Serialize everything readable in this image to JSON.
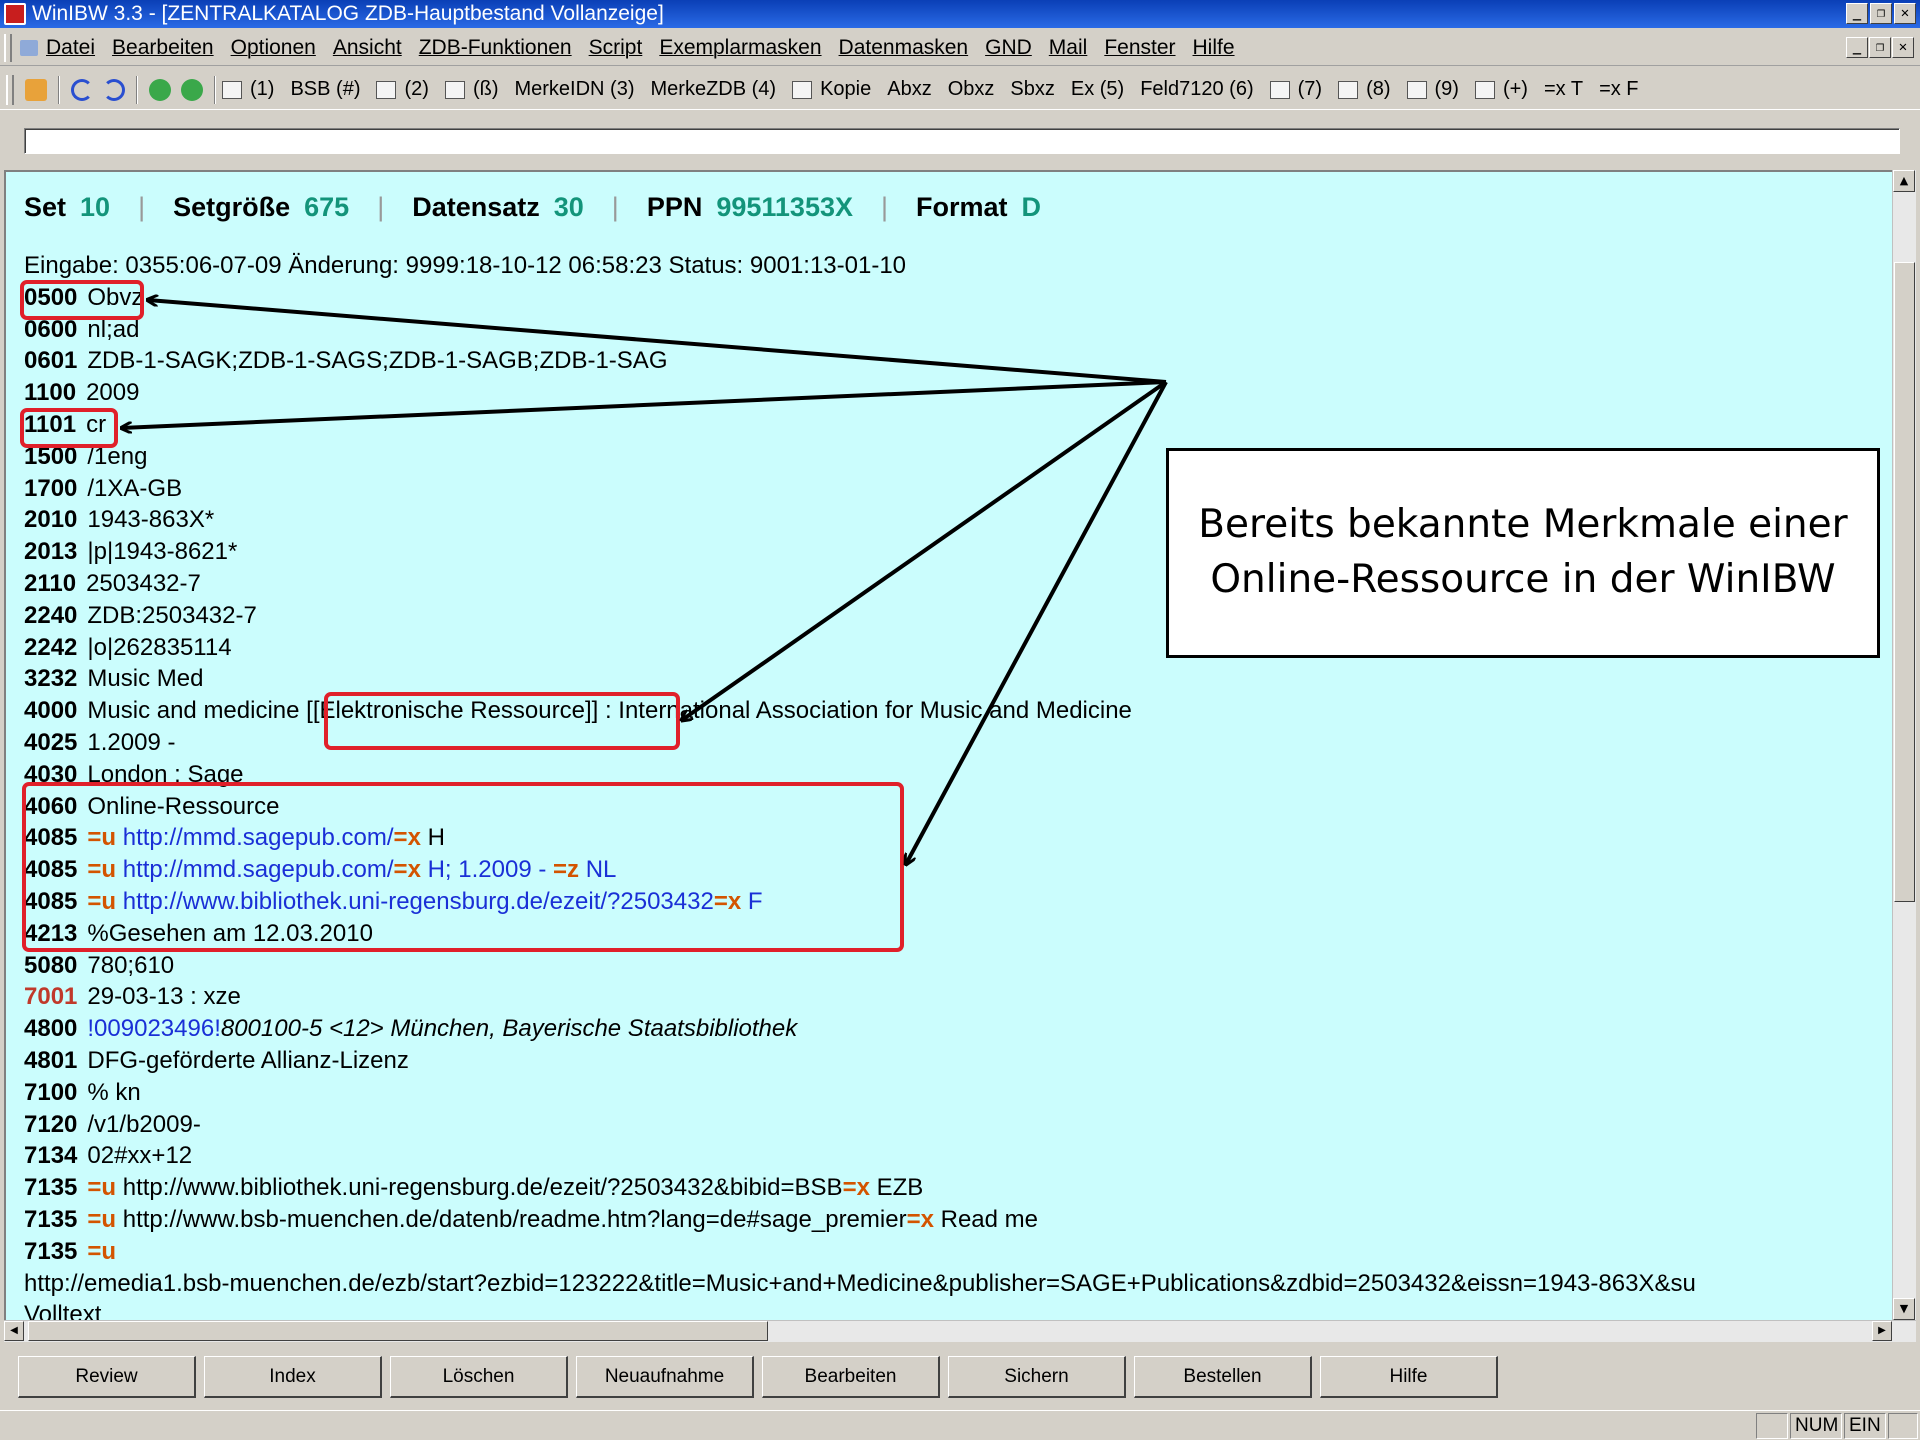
{
  "window": {
    "title": "WinIBW 3.3 - [ZENTRALKATALOG ZDB-Hauptbestand Vollanzeige]",
    "controls": [
      "_",
      "❐",
      "✕"
    ]
  },
  "menu": {
    "items": [
      "Datei",
      "Bearbeiten",
      "Optionen",
      "Ansicht",
      "ZDB-Funktionen",
      "Script",
      "Exemplarmasken",
      "Datenmasken",
      "GND",
      "Mail",
      "Fenster",
      "Hilfe"
    ],
    "mdi_controls": [
      "_",
      "❐",
      "✕"
    ]
  },
  "toolbar": {
    "items": [
      "(1)",
      "BSB (#)",
      "(2)",
      "(ß)",
      "MerkeIDN (3)",
      "MerkeZDB (4)",
      "Kopie",
      "Abxz",
      "Obxz",
      "Sbxz",
      "Ex (5)",
      "Feld7120 (6)",
      "(7)",
      "(8)",
      "(9)",
      "(+)",
      "=x T",
      "=x F"
    ]
  },
  "command": {
    "value": ""
  },
  "record_header": {
    "set_label": "Set",
    "set_value": "10",
    "setsize_label": "Setgröße",
    "setsize_value": "675",
    "record_label": "Datensatz",
    "record_value": "30",
    "ppn_label": "PPN",
    "ppn_value": "99511353X",
    "format_label": "Format",
    "format_value": "D",
    "divider": "|"
  },
  "record": {
    "entry": "Eingabe: 0355:06-07-09 Änderung: 9999:18-10-12 06:58:23 Status: 9001:13-01-10",
    "fields": [
      {
        "tag": "0500",
        "text": "Obvz"
      },
      {
        "tag": "0600",
        "text": "nl;ad"
      },
      {
        "tag": "0601",
        "text": "ZDB-1-SAGK;ZDB-1-SAGS;ZDB-1-SAGB;ZDB-1-SAG"
      },
      {
        "tag": "1100",
        "text": "2009"
      },
      {
        "tag": "1101",
        "text": "cr"
      },
      {
        "tag": "1500",
        "text": "/1eng"
      },
      {
        "tag": "1700",
        "text": "/1XA-GB"
      },
      {
        "tag": "2010",
        "text": "1943-863X*"
      },
      {
        "tag": "2013",
        "text": "|p|1943-8621*"
      },
      {
        "tag": "2110",
        "text": "2503432-7"
      },
      {
        "tag": "2240",
        "text": "ZDB:2503432-7"
      },
      {
        "tag": "2242",
        "text": "|o|262835114"
      },
      {
        "tag": "3232",
        "text": "Music Med"
      },
      {
        "tag": "4000",
        "pre": "Music and medicine ",
        "mid": "[[Elektronische Ressource]]",
        "post": " : International Association for Music and Medicine"
      },
      {
        "tag": "4025",
        "text": "1.2009 -"
      },
      {
        "tag": "4030",
        "text": "London : Sage"
      },
      {
        "tag": "4060",
        "text": "Online-Ressource"
      },
      {
        "tag": "4085",
        "s1": "=u",
        "url": "http://mmd.sagepub.com/",
        "s2": "=x",
        "tail": "H"
      },
      {
        "tag": "4085",
        "s1": "=u",
        "url": "http://mmd.sagepub.com/",
        "s2": "=x",
        "tail": "H; 1.2009 -",
        "s3": "=z",
        "tail2": "NL"
      },
      {
        "tag": "4085",
        "s1": "=u",
        "url": "http://www.bibliothek.uni-regensburg.de/ezeit/?2503432",
        "s2": "=x",
        "tail": "F"
      },
      {
        "tag": "4213",
        "text": "%Gesehen am 12.03.2010"
      },
      {
        "tag": "5080",
        "text": "780;610"
      },
      {
        "tag": "7001",
        "text": "29-03-13 : xze"
      },
      {
        "tag": "4800",
        "link": "!009023496!",
        "ital": "800100-5 <12> München, Bayerische Staatsbibliothek"
      },
      {
        "tag": "4801",
        "text": "DFG-geförderte Allianz-Lizenz"
      },
      {
        "tag": "7100",
        "text": "% kn"
      },
      {
        "tag": "7120",
        "text": "/v1/b2009-"
      },
      {
        "tag": "7134",
        "text": "02#xx+12"
      },
      {
        "tag": "7135",
        "s1": "=u",
        "plain": "http://www.bibliothek.uni-regensburg.de/ezeit/?2503432&bibid=BSB",
        "s2": "=x",
        "tail": "EZB"
      },
      {
        "tag": "7135",
        "s1": "=u",
        "plain": "http://www.bsb-muenchen.de/datenb/readme.htm?lang=de#sage_premier",
        "s2": "=x",
        "tail": "Read me"
      },
      {
        "tag": "7135",
        "s1": "=u"
      }
    ],
    "wrap1": "http://emedia1.bsb-muenchen.de/ezb/start?ezbid=123222&title=Music+and+Medicine&publisher=SAGE+Publications&zdbid=2503432&eissn=1943-863X&su",
    "wrap2": "Volltext"
  },
  "annotation": {
    "text": "Bereits bekannte Merkmale einer\nOnline-Ressource in der WinIBW"
  },
  "colors": {
    "record_bg": "#cbfdfd",
    "header_values": "#13947a",
    "highlight": "#e0202a",
    "url": "#1a2fd6",
    "subfield": "#d35400"
  },
  "buttons": [
    "Review",
    "Index",
    "Löschen",
    "Neuaufnahme",
    "Bearbeiten",
    "Sichern",
    "Bestellen",
    "Hilfe"
  ],
  "status": {
    "num": "NUM",
    "ein": "EIN"
  }
}
